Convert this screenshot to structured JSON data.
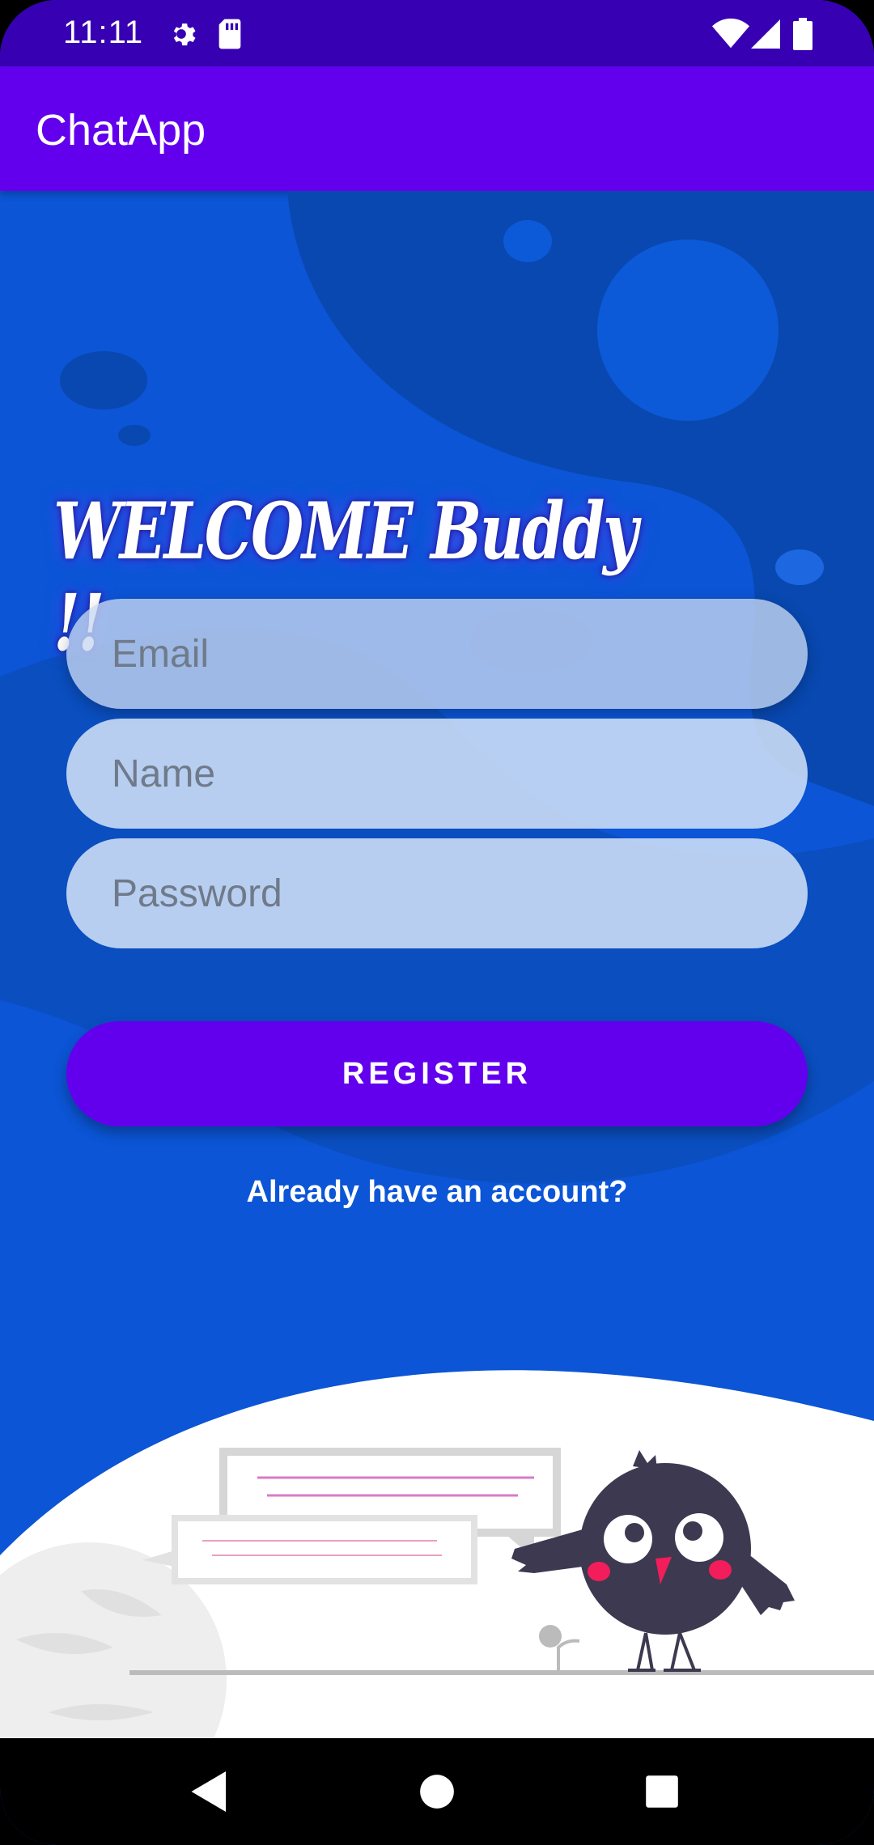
{
  "status_bar": {
    "time": "11:11",
    "icons": [
      "settings-icon",
      "sd-card-icon",
      "wifi-icon",
      "signal-icon",
      "battery-icon"
    ]
  },
  "app_bar": {
    "title": "ChatApp"
  },
  "welcome": {
    "text": "WELCOME Buddy !!"
  },
  "form": {
    "email": {
      "placeholder": "Email",
      "value": ""
    },
    "name": {
      "placeholder": "Name",
      "value": ""
    },
    "password": {
      "placeholder": "Password",
      "value": ""
    }
  },
  "register_button": {
    "label": "REGISTER"
  },
  "login_link": {
    "label": "Already have an account?"
  },
  "nav_bar": {
    "icons": [
      "back-icon",
      "home-icon",
      "recents-icon"
    ]
  },
  "colors": {
    "status_bar": "#3700B3",
    "app_bar": "#6200EE",
    "background": "#0B55D6",
    "button": "#6200EE"
  }
}
